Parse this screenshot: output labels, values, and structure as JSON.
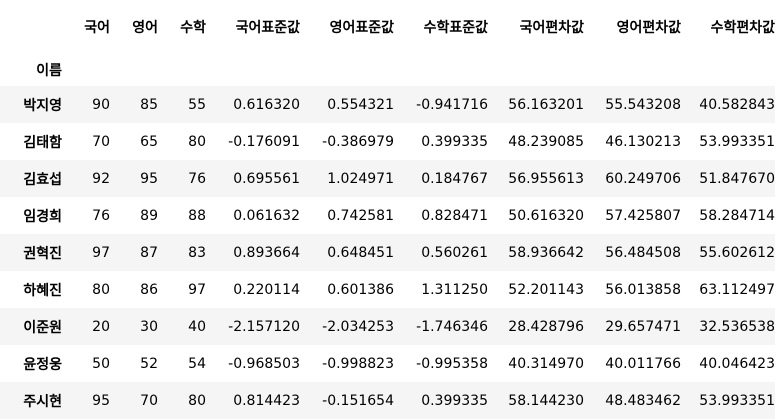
{
  "table": {
    "index_name": "이름",
    "columns": [
      "국어",
      "영어",
      "수학",
      "국어표준값",
      "영어표준값",
      "수학표준값",
      "국어편차값",
      "영어편차값",
      "수학편차값"
    ],
    "rows": [
      {
        "name": "박지영",
        "values": [
          "90",
          "85",
          "55",
          "0.616320",
          "0.554321",
          "-0.941716",
          "56.163201",
          "55.543208",
          "40.582843"
        ]
      },
      {
        "name": "김태함",
        "values": [
          "70",
          "65",
          "80",
          "-0.176091",
          "-0.386979",
          "0.399335",
          "48.239085",
          "46.130213",
          "53.993351"
        ]
      },
      {
        "name": "김효섭",
        "values": [
          "92",
          "95",
          "76",
          "0.695561",
          "1.024971",
          "0.184767",
          "56.955613",
          "60.249706",
          "51.847670"
        ]
      },
      {
        "name": "임경희",
        "values": [
          "76",
          "89",
          "88",
          "0.061632",
          "0.742581",
          "0.828471",
          "50.616320",
          "57.425807",
          "58.284714"
        ]
      },
      {
        "name": "권혁진",
        "values": [
          "97",
          "87",
          "83",
          "0.893664",
          "0.648451",
          "0.560261",
          "58.936642",
          "56.484508",
          "55.602612"
        ]
      },
      {
        "name": "하혜진",
        "values": [
          "80",
          "86",
          "97",
          "0.220114",
          "0.601386",
          "1.311250",
          "52.201143",
          "56.013858",
          "63.112497"
        ]
      },
      {
        "name": "이준원",
        "values": [
          "20",
          "30",
          "40",
          "-2.157120",
          "-2.034253",
          "-1.746346",
          "28.428796",
          "29.657471",
          "32.536538"
        ]
      },
      {
        "name": "윤정웅",
        "values": [
          "50",
          "52",
          "54",
          "-0.968503",
          "-0.998823",
          "-0.995358",
          "40.314970",
          "40.011766",
          "40.046423"
        ]
      },
      {
        "name": "주시현",
        "values": [
          "95",
          "70",
          "80",
          "0.814423",
          "-0.151654",
          "0.399335",
          "58.144230",
          "48.483462",
          "53.993351"
        ]
      }
    ]
  }
}
